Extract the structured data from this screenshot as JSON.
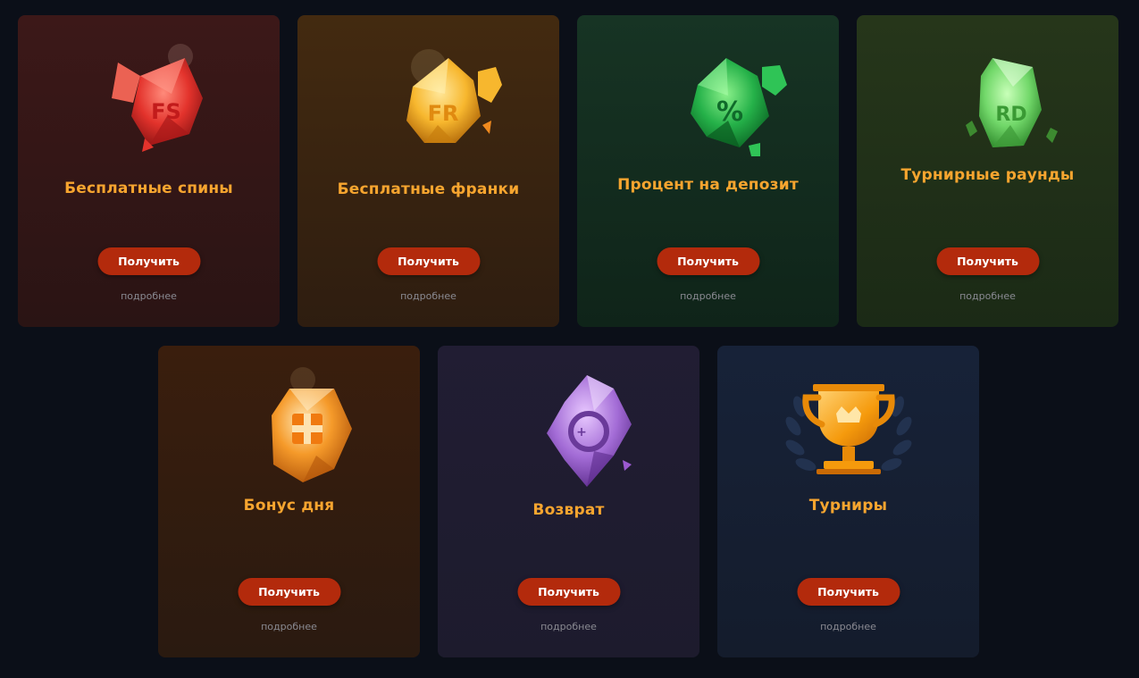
{
  "common": {
    "button_label": "Получить",
    "more_label": "подробнее"
  },
  "colors": {
    "page_background": "#0b0f18",
    "title": "#f7a52f",
    "button": "#b32a0c",
    "more_link": "#8a8a92"
  },
  "cards": [
    {
      "title": "Бесплатные спины",
      "icon": "red-gem-fs-icon",
      "icon_text": "FS",
      "accent": "#e8312f"
    },
    {
      "title": "Бесплатные франки",
      "icon": "yellow-gem-fr-icon",
      "icon_text": "FR",
      "accent": "#f5a623"
    },
    {
      "title": "Процент на депозит",
      "icon": "green-gem-percent-icon",
      "icon_text": "%",
      "accent": "#22b14c"
    },
    {
      "title": "Турнирные раунды",
      "icon": "lime-gem-rd-icon",
      "icon_text": "RD",
      "accent": "#6ed56a"
    },
    {
      "title": "Бонус дня",
      "icon": "orange-gem-gift-icon",
      "icon_text": "",
      "accent": "#f08a1e"
    },
    {
      "title": "Возврат",
      "icon": "purple-gem-refund-icon",
      "icon_text": "",
      "accent": "#9b59d0"
    },
    {
      "title": "Турниры",
      "icon": "trophy-icon",
      "icon_text": "",
      "accent": "#f59a0c"
    }
  ]
}
